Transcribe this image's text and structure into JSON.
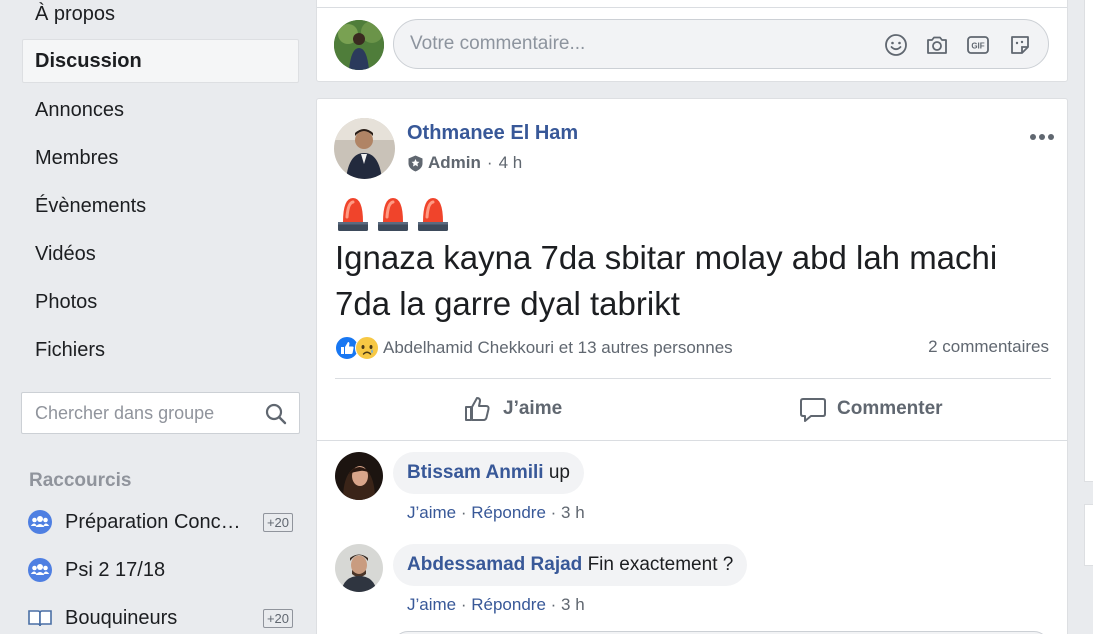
{
  "sidebar": {
    "nav": [
      {
        "label": "À propos"
      },
      {
        "label": "Discussion"
      },
      {
        "label": "Annonces"
      },
      {
        "label": "Membres"
      },
      {
        "label": "Évènements"
      },
      {
        "label": "Vidéos"
      },
      {
        "label": "Photos"
      },
      {
        "label": "Fichiers"
      }
    ],
    "search_placeholder": "Chercher dans groupe",
    "shortcuts_title": "Raccourcis",
    "shortcuts": [
      {
        "label": "Préparation Conco…",
        "badge": "+20",
        "icon": "group-icon"
      },
      {
        "label": "Psi 2 17/18",
        "badge": "",
        "icon": "group-icon"
      },
      {
        "label": "Bouquineurs",
        "badge": "+20",
        "icon": "book-icon"
      }
    ]
  },
  "composer": {
    "placeholder": "Votre commentaire..."
  },
  "post": {
    "author": "Othmanee El Ham",
    "role": "Admin",
    "time": "4 h",
    "text": "Ignaza kayna 7da sbitar molay abd lah machi 7da la garre dyal tabrikt",
    "likers": "Abdelhamid Chekkouri et 13 autres personnes",
    "comments_count": "2 commentaires",
    "like_label": "J’aime",
    "comment_label": "Commenter"
  },
  "comments": [
    {
      "author": "Btissam Anmili",
      "text": "up",
      "like": "J’aime",
      "reply": "Répondre",
      "time": "3 h"
    },
    {
      "author": "Abdessamad Rajad",
      "text": "Fin exactement ?",
      "like": "J’aime",
      "reply": "Répondre",
      "time": "3 h"
    }
  ],
  "colors": {
    "link": "#385898",
    "like_blue": "#1877f2",
    "secondary_text": "#606770",
    "page_bg": "#e9ebee"
  }
}
